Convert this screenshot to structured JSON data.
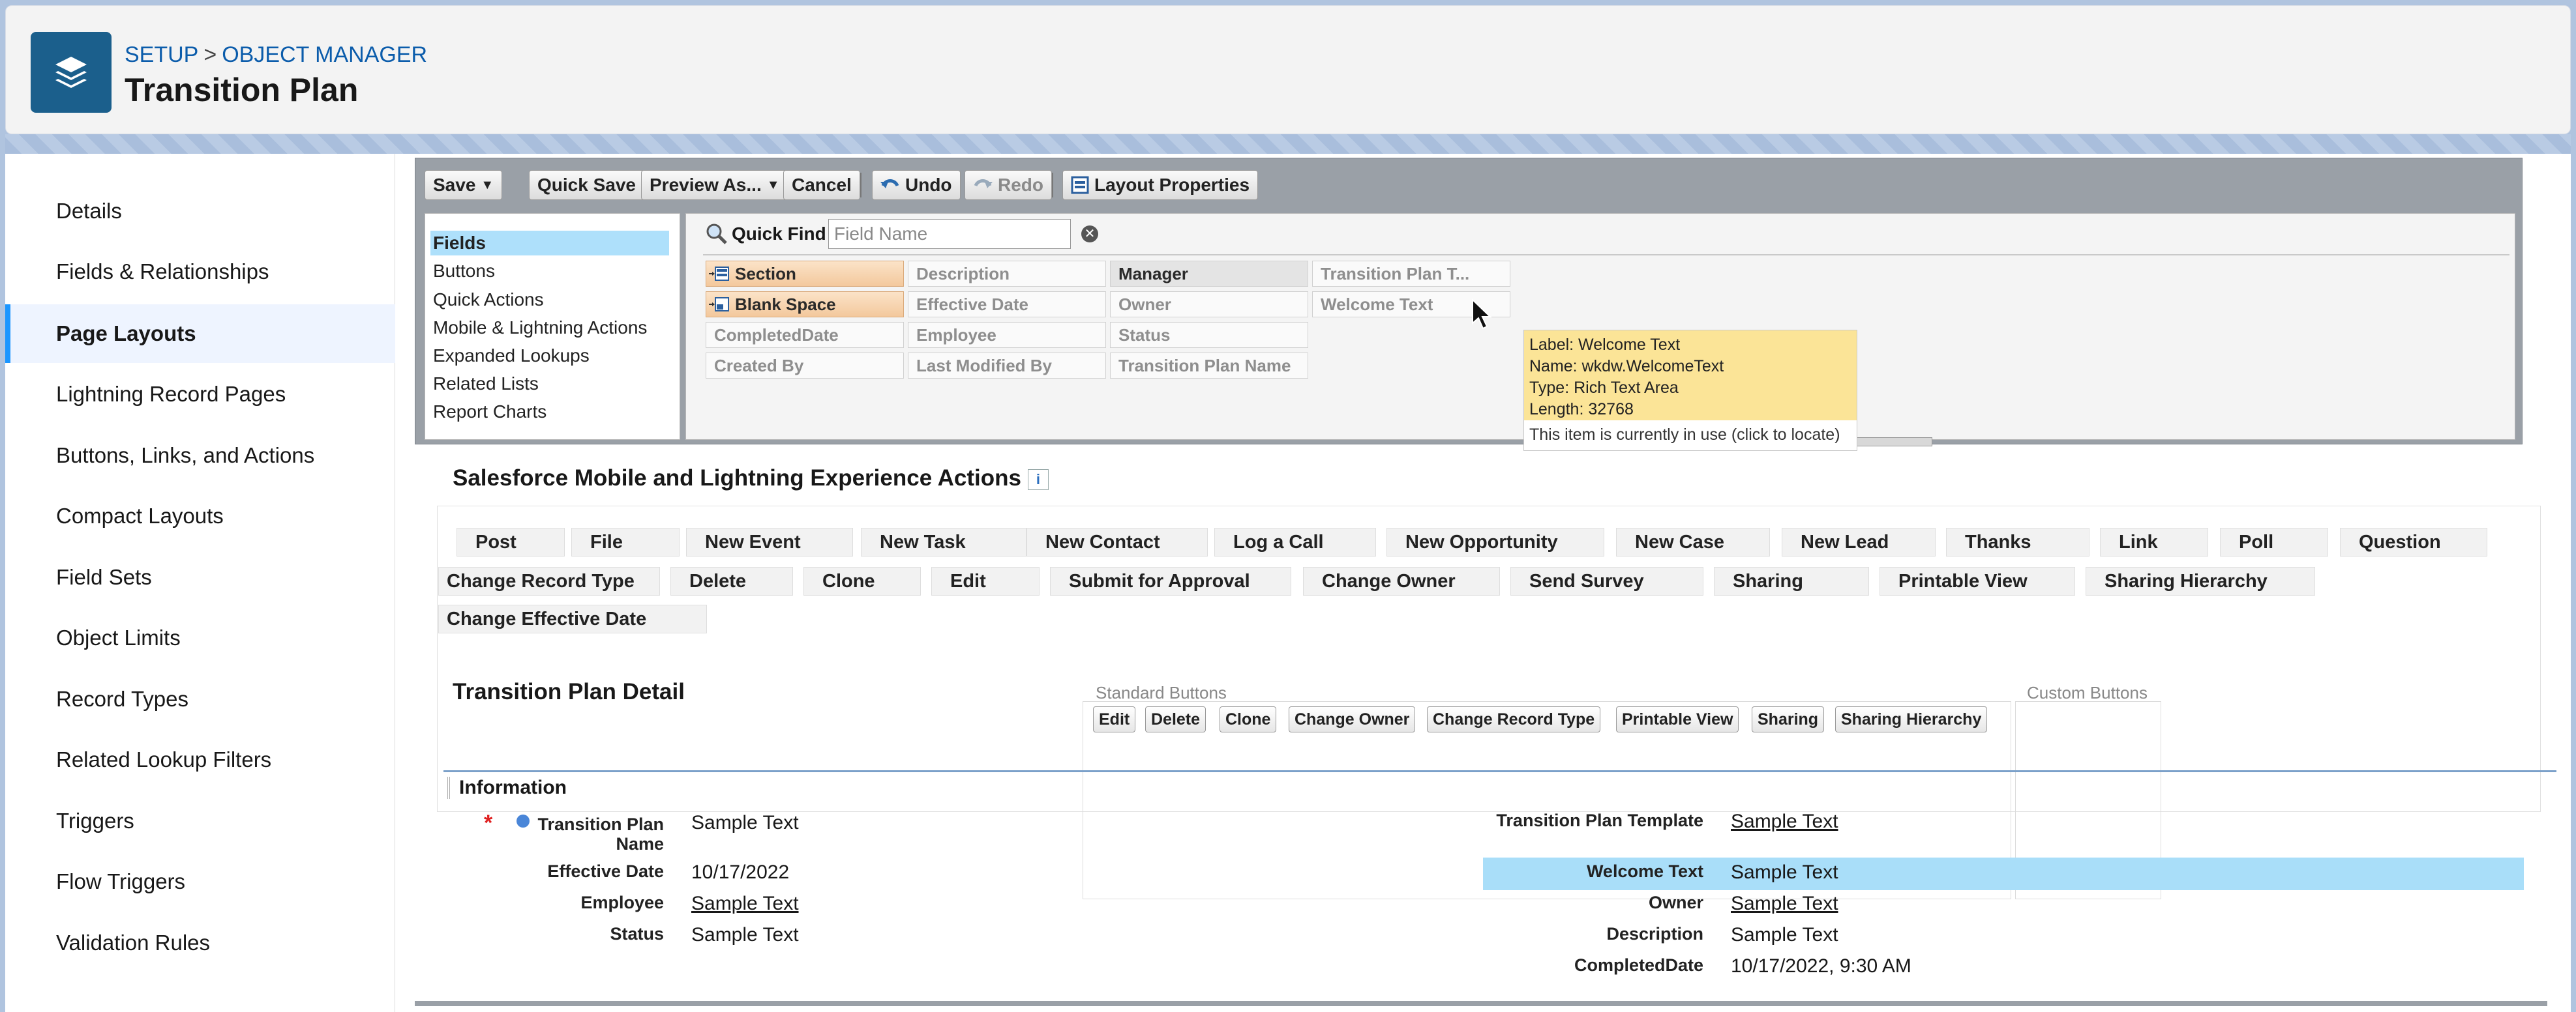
{
  "header": {
    "breadcrumb": [
      "SETUP",
      "OBJECT MANAGER"
    ],
    "separator": ">",
    "title": "Transition Plan",
    "icon": "stacked-layers-icon"
  },
  "sidebar": {
    "items": [
      {
        "label": "Details"
      },
      {
        "label": "Fields & Relationships"
      },
      {
        "label": "Page Layouts",
        "active": true
      },
      {
        "label": "Lightning Record Pages"
      },
      {
        "label": "Buttons, Links, and Actions"
      },
      {
        "label": "Compact Layouts"
      },
      {
        "label": "Field Sets"
      },
      {
        "label": "Object Limits"
      },
      {
        "label": "Record Types"
      },
      {
        "label": "Related Lookup Filters"
      },
      {
        "label": "Triggers"
      },
      {
        "label": "Flow Triggers"
      },
      {
        "label": "Validation Rules"
      }
    ]
  },
  "toolbar": {
    "save": "Save",
    "quick_save": "Quick Save",
    "preview_as": "Preview As...",
    "cancel": "Cancel",
    "undo": "Undo",
    "redo": "Redo",
    "layout_properties": "Layout Properties"
  },
  "palette": {
    "categories": [
      {
        "label": "Fields",
        "active": true
      },
      {
        "label": "Buttons"
      },
      {
        "label": "Quick Actions"
      },
      {
        "label": "Mobile & Lightning Actions"
      },
      {
        "label": "Expanded Lookups"
      },
      {
        "label": "Related Lists"
      },
      {
        "label": "Report Charts"
      }
    ],
    "quick_find_label": "Quick Find",
    "quick_find_placeholder": "Field Name",
    "fields": [
      [
        "Section",
        "Description",
        "Manager",
        "Transition Plan T..."
      ],
      [
        "Blank Space",
        "Effective Date",
        "Owner",
        "Welcome Text"
      ],
      [
        "CompletedDate",
        "Employee",
        "Status"
      ],
      [
        "Created By",
        "Last Modified By",
        "Transition Plan Name"
      ]
    ],
    "tooltip": {
      "lines": [
        "Label: Welcome Text",
        "Name: wkdw.WelcomeText",
        "Type: Rich Text Area",
        "Length: 32768"
      ],
      "footer": "This item is currently in use (click to locate)"
    }
  },
  "actions_section": {
    "title": "Salesforce Mobile and Lightning Experience Actions",
    "info_icon": "i",
    "rows": [
      [
        "Post",
        "File",
        "New Event",
        "New Task",
        "New Contact",
        "Log a Call",
        "New Opportunity",
        "New Case",
        "New Lead",
        "Thanks",
        "Link",
        "Poll",
        "Question"
      ],
      [
        "Change Record Type",
        "Delete",
        "Clone",
        "Edit",
        "Submit for Approval",
        "Change Owner",
        "Send Survey",
        "Sharing",
        "Printable View",
        "Sharing Hierarchy"
      ],
      [
        "Change Effective Date"
      ]
    ]
  },
  "detail": {
    "title": "Transition Plan Detail",
    "standard_buttons_label": "Standard Buttons",
    "custom_buttons_label": "Custom Buttons",
    "standard_buttons": [
      "Edit",
      "Delete",
      "Clone",
      "Change Owner",
      "Change Record Type",
      "Printable View",
      "Sharing",
      "Sharing Hierarchy"
    ],
    "section_title": "Information",
    "left_fields": [
      {
        "label": "Transition Plan Name",
        "value": "Sample Text",
        "link": false
      },
      {
        "label": "Effective Date",
        "value": "10/17/2022",
        "link": false
      },
      {
        "label": "Employee",
        "value": "Sample Text",
        "link": true
      },
      {
        "label": "Status",
        "value": "Sample Text",
        "link": false
      }
    ],
    "right_fields": [
      {
        "label": "Transition Plan Template",
        "value": "Sample Text",
        "link": true
      },
      {
        "label": "Welcome Text",
        "value": "Sample Text",
        "link": false
      },
      {
        "label": "Owner",
        "value": "Sample Text",
        "link": true
      },
      {
        "label": "Description",
        "value": "Sample Text",
        "link": false
      },
      {
        "label": "CompletedDate",
        "value": "10/17/2022, 9:30 AM",
        "link": false
      }
    ]
  },
  "colors": {
    "accent": "#0b5cab",
    "highlight": "#a9def9",
    "tooltip": "#fbe497",
    "active_nav": "#1b96ff"
  }
}
